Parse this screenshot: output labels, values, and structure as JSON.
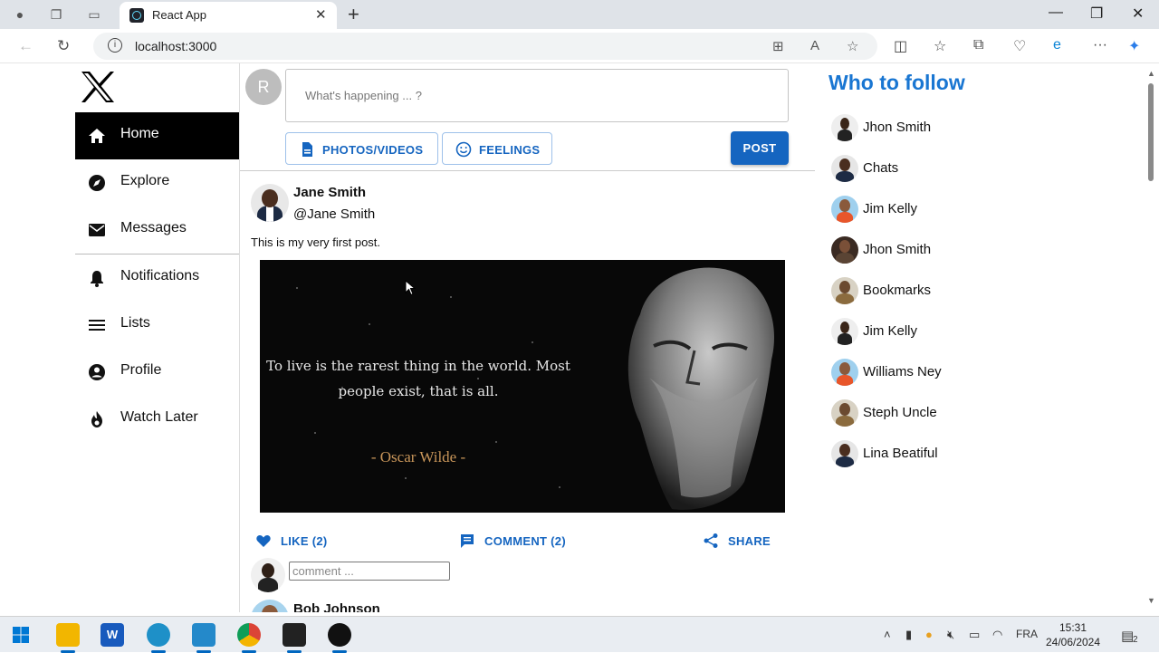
{
  "browser": {
    "tab_title": "React App",
    "url": "localhost:3000"
  },
  "sidebar": {
    "items": [
      {
        "label": "Home",
        "icon": "home-icon",
        "active": true
      },
      {
        "label": "Explore",
        "icon": "explore-icon"
      },
      {
        "label": "Messages",
        "icon": "mail-icon"
      },
      {
        "label": "Notifications",
        "icon": "bell-icon"
      },
      {
        "label": "Lists",
        "icon": "list-icon"
      },
      {
        "label": "Profile",
        "icon": "profile-icon"
      },
      {
        "label": "Watch Later",
        "icon": "flame-icon"
      }
    ]
  },
  "composer": {
    "avatar_letter": "R",
    "placeholder": "What's happening ... ?",
    "photos_label": "PHOTOS/VIDEOS",
    "feelings_label": "FEELINGS",
    "post_label": "POST"
  },
  "post": {
    "author_name": "Jane Smith",
    "author_handle": "@Jane Smith",
    "text": "This is my very first post.",
    "image": {
      "quote_line1": "To live is the rarest thing in the world. Most",
      "quote_line2": "people exist, that is all.",
      "quote_author": "- Oscar Wilde -"
    },
    "like_label": "LIKE (2)",
    "comment_label": "COMMENT (2)",
    "share_label": "SHARE",
    "comment_placeholder": "comment ..."
  },
  "next_post": {
    "author_name": "Bob Johnson"
  },
  "who_to_follow": {
    "title": "Who to follow",
    "people": [
      {
        "name": "Jhon Smith"
      },
      {
        "name": "Chats"
      },
      {
        "name": "Jim Kelly"
      },
      {
        "name": "Jhon Smith"
      },
      {
        "name": "Bookmarks"
      },
      {
        "name": "Jim Kelly"
      },
      {
        "name": "Williams Ney"
      },
      {
        "name": "Steph Uncle"
      },
      {
        "name": "Lina Beatiful"
      }
    ]
  },
  "taskbar": {
    "language": "FRA",
    "time": "15:31",
    "date": "24/06/2024",
    "notification_count": "2"
  },
  "colors": {
    "accent": "#1565c0",
    "title_blue": "#1976d2",
    "active_nav_bg": "#000000"
  }
}
